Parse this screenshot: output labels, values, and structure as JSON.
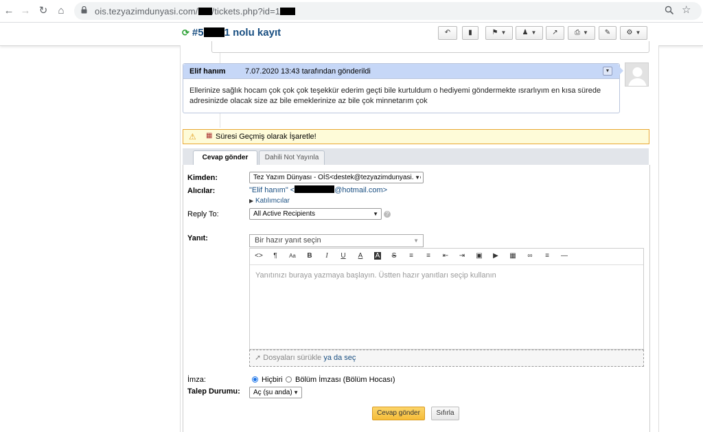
{
  "browser": {
    "url_domain": "ois.tezyazimdunyasi.com/",
    "url_path": "/tickets.php?id=1",
    "zoom_icon": "zoom-icon",
    "star_icon": "star-icon"
  },
  "toolbar": {
    "ticket_prefix": "#5",
    "ticket_suffix": "1 nolu kayıt",
    "refresh_icon": "refresh-icon",
    "buttons": [
      "reply-icon",
      "print-doc-icon",
      "flag-icon",
      "assign-user-icon",
      "transfer-icon",
      "printer-icon",
      "edit-icon",
      "settings-icon"
    ]
  },
  "message": {
    "author": "Elif hanım",
    "meta": "7.07.2020 13:43 tarafından gönderildi",
    "body": "Ellerinize sağlık hocam çok çok çok teşekkür ederim geçti bile kurtuldum o hediyemi göndermekte ısrarlıyım en kısa sürede adresinizde olacak size az bile emeklerinize az bile çok minnetarım çok"
  },
  "notice": {
    "text": "Süresi Geçmiş olarak İşaretle!"
  },
  "tabs": {
    "reply": "Cevap gönder",
    "note": "Dahili Not Yayınla"
  },
  "form": {
    "from_label": "Kimden:",
    "from_value": "Tez Yazım Dünyası - OİS<destek@tezyazimdunyasi.co",
    "recipients_label": "Alıcılar:",
    "recipient_name": "\"Elif hanım\" <",
    "recipient_domain": "@hotmail.com>",
    "participants_link": "Katılımcılar",
    "reply_to_label": "Reply To:",
    "reply_to_value": "All Active Recipients",
    "response_label": "Yanıt:",
    "canned_placeholder": "Bir hazır yanıt seçin",
    "editor_placeholder": "Yanıtınızı buraya yazmaya başlayın. Üstten hazır yanıtları seçip kullanın",
    "dropzone_text": "Dosyaları sürükle",
    "dropzone_link": "ya da seç",
    "signature_label": "İmza:",
    "signature_none": "Hiçbiri",
    "signature_dept": "Bölüm İmzası (Bölüm Hocası)",
    "status_label": "Talep Durumu:",
    "status_value": "Aç (şu anda)",
    "submit_label": "Cevap gönder",
    "reset_label": "Sıfırla"
  }
}
